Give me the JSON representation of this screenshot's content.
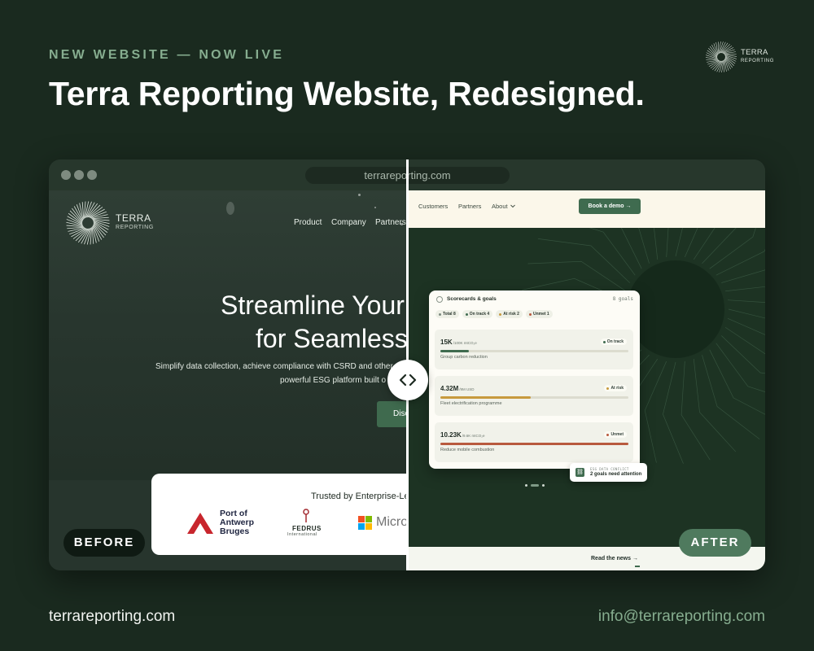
{
  "header": {
    "eyebrow": "NEW WEBSITE — NOW LIVE",
    "headline": "Terra Reporting Website, Redesigned.",
    "logo_name": "TERRA",
    "logo_sub": "REPORTING"
  },
  "browser": {
    "url": "terrareporting.com"
  },
  "before": {
    "logo_name": "TERRA",
    "logo_sub": "REPORTING",
    "nav": [
      "Product",
      "Company",
      "Partners"
    ],
    "hero_line1": "Streamline Your",
    "hero_line2": "for Seamless",
    "sub_line1": "Simplify data collection, achieve compliance with CSRD and other",
    "sub_line2": "powerful ESG platform built o",
    "cta_label": "Disc",
    "trust_title": "Trusted by Enterprise-Le",
    "trust_logos": {
      "port_line1": "Port of",
      "port_line2": "Antwerp",
      "port_line3": "Bruges",
      "fedrus": "FEDRUS",
      "fedrus_sub": "International",
      "microsoft": "Micro"
    }
  },
  "after": {
    "nav": [
      "Customers",
      "Partners",
      "About"
    ],
    "demo_label": "Book a demo →",
    "news_label": "Read the news →"
  },
  "scorecard": {
    "title": "Scorecards & goals",
    "count": "8 goals",
    "chips": [
      {
        "label": "Total 8",
        "color": "#7c8a7f"
      },
      {
        "label": "On track 4",
        "color": "#3f6b4f"
      },
      {
        "label": "At risk 2",
        "color": "#c79a3e"
      },
      {
        "label": "Unmet 1",
        "color": "#b85a3e"
      }
    ],
    "goals": [
      {
        "value": "15K",
        "unit": "/100K mtCO₂e",
        "status": "On track",
        "label": "Group carbon reduction",
        "progress": 0.15,
        "color": "#3f6b4f"
      },
      {
        "value": "4.32M",
        "unit": "/9M USD",
        "status": "At risk",
        "label": "Fleet electrification programme",
        "progress": 0.48,
        "color": "#c79a3e"
      },
      {
        "value": "10.23K",
        "unit": "/9.6K mtCO₂e",
        "status": "Unmet",
        "label": "Reduce mobile combustion",
        "progress": 1.0,
        "color": "#b85a3e"
      }
    ],
    "toast_kicker": "ESG DATA CONFLICT",
    "toast_text": "2 goals need attention"
  },
  "labels": {
    "before": "BEFORE",
    "after": "AFTER"
  },
  "footer": {
    "left": "terrareporting.com",
    "right": "info@terrareporting.com"
  },
  "colors": {
    "background": "#1a2a1f",
    "accent": "#86ad8f",
    "brand_green": "#3f6b4f"
  }
}
